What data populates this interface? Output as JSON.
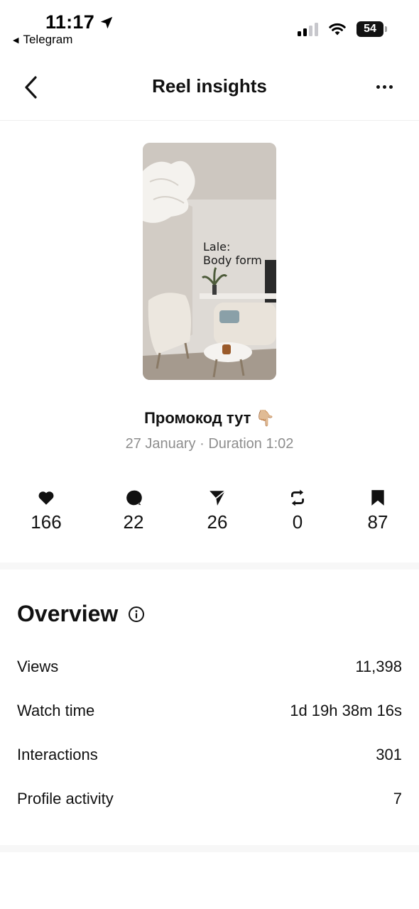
{
  "status_bar": {
    "time": "11:17",
    "back_app": "Telegram",
    "battery": "54"
  },
  "nav": {
    "title": "Reel insights"
  },
  "reel": {
    "thumbnail_text_line1": "Lale:",
    "thumbnail_text_line2": "Body form",
    "caption": "Промокод тут 👇🏼",
    "meta": "27 January · Duration 1:02"
  },
  "stats": [
    {
      "icon": "heart-icon",
      "value": "166"
    },
    {
      "icon": "comment-icon",
      "value": "22"
    },
    {
      "icon": "share-icon",
      "value": "26"
    },
    {
      "icon": "repost-icon",
      "value": "0"
    },
    {
      "icon": "bookmark-icon",
      "value": "87"
    }
  ],
  "overview": {
    "title": "Overview",
    "metrics": [
      {
        "label": "Views",
        "value": "11,398"
      },
      {
        "label": "Watch time",
        "value": "1d 19h 38m 16s"
      },
      {
        "label": "Interactions",
        "value": "301"
      },
      {
        "label": "Profile activity",
        "value": "7"
      }
    ]
  },
  "colors": {
    "text": "#111111",
    "secondary_text": "#8e8e8e",
    "divider": "#f7f7f7"
  }
}
